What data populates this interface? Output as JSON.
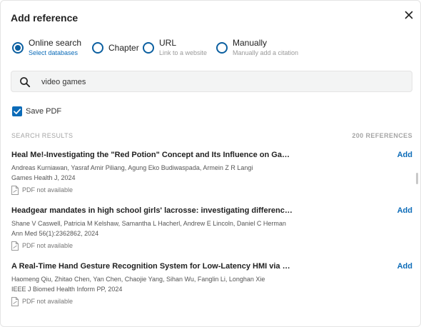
{
  "dialog": {
    "title": "Add reference",
    "close_icon": "close-icon"
  },
  "options": [
    {
      "label": "Online search",
      "sublabel": "Select databases",
      "checked": true
    },
    {
      "label": "Chapter",
      "sublabel": "",
      "checked": false
    },
    {
      "label": "URL",
      "sublabel": "Link to a website",
      "checked": false
    },
    {
      "label": "Manually",
      "sublabel": "Manually add a citation",
      "checked": false
    }
  ],
  "search": {
    "value": "video games",
    "icon": "search-icon"
  },
  "save_pdf": {
    "label": "Save PDF",
    "checked": true
  },
  "results": {
    "header_label": "SEARCH RESULTS",
    "count_label": "200 REFERENCES",
    "add_label": "Add",
    "pdf_status": "PDF not available",
    "items": [
      {
        "title": "Heal Me!-Investigating the \"Red Potion\" Concept and Its Influence on Gamers' Cardiac Responses",
        "authors": "Andreas Kurniawan, Yasraf Amir Piliang, Agung Eko Budiwaspada, Armein Z R Langi",
        "journal": "Games Health J, 2024"
      },
      {
        "title": "Headgear mandates in high school girls' lacrosse: investigating differences in impact exposure",
        "authors": "Shane V Caswell, Patricia M Kelshaw, Samantha L Hacherl, Andrew E Lincoln, Daniel C Herman",
        "journal": "Ann Med 56(1):2362862, 2024"
      },
      {
        "title": "A Real-Time Hand Gesture Recognition System for Low-Latency HMI via Transient HD-sEMG",
        "authors": "Haomeng Qiu, Zhitao Chen, Yan Chen, Chaojie Yang, Sihan Wu, Fanglin Li, Longhan Xie",
        "journal": "IEEE J Biomed Health Inform PP, 2024"
      }
    ]
  }
}
